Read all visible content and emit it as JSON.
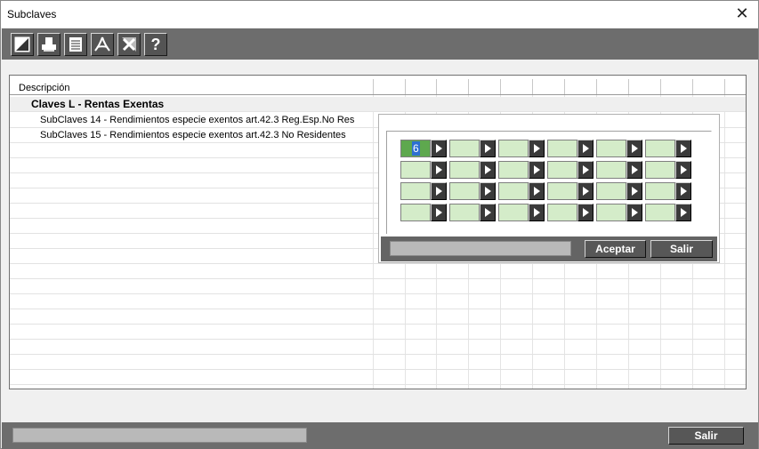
{
  "window": {
    "title": "Subclaves"
  },
  "toolbar": {
    "icons": [
      "edit-icon",
      "print-icon",
      "list-icon",
      "pdf-icon",
      "excel-icon",
      "help-icon"
    ],
    "help_label": "?"
  },
  "grid": {
    "header": "Descripción",
    "group": "Claves L - Rentas Exentas",
    "items": [
      "SubClaves 14 - Rendimientos especie exentos art.42.3 Reg.Esp.No Res",
      "SubClaves 15 - Rendimientos especie exentos art.42.3 No Residentes"
    ]
  },
  "popup": {
    "rows": 4,
    "cols": 6,
    "active_value": "6",
    "accept_label": "Aceptar",
    "exit_label": "Salir"
  },
  "footer": {
    "exit_label": "Salir"
  },
  "colors": {
    "toolbar": "#6d6d6d",
    "cell_field": "#d4ecc9",
    "cell_active": "#5ea84e",
    "selection": "#2d6fd1"
  }
}
